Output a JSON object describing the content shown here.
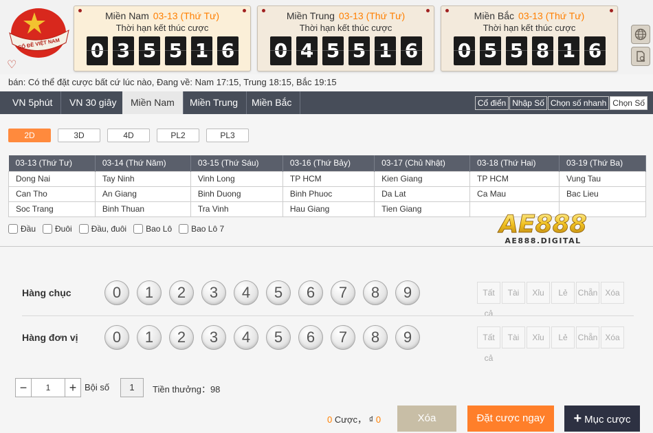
{
  "brand": {
    "logo_text": "SỐ ĐỀ VIỆT NAM",
    "colors": {
      "red": "#d8281d",
      "gold": "#f2c230",
      "orange": "#ff7f2a",
      "dark": "#474d59"
    }
  },
  "panels": [
    {
      "region": "Miền Nam",
      "date": "03-13 (Thứ Tư)",
      "subtitle": "Thời hạn kết thúc cược",
      "digits": [
        "0",
        "3",
        "5",
        "5",
        "1",
        "6"
      ]
    },
    {
      "region": "Miền Trung",
      "date": "03-13 (Thứ Tư)",
      "subtitle": "Thời hạn kết thúc cược",
      "digits": [
        "0",
        "4",
        "5",
        "5",
        "1",
        "6"
      ]
    },
    {
      "region": "Miền Bắc",
      "date": "03-13 (Thứ Tư)",
      "subtitle": "Thời hạn kết thúc cược",
      "digits": [
        "0",
        "5",
        "5",
        "8",
        "1",
        "6"
      ]
    }
  ],
  "side_icons": [
    "globe-icon",
    "document-icon"
  ],
  "ticker": "bán: Có thể đặt cược bất cứ lúc nào,   Đang về: Nam 17:15, Trung 18:15, Bắc 19:15",
  "tabs": [
    "VN 5phút",
    "VN 30 giây",
    "Miền Nam",
    "Miền Trung",
    "Miền Bắc"
  ],
  "active_tab": "Miền Nam",
  "modes": [
    "Cổ điển",
    "Nhập Số",
    "Chọn số nhanh",
    "Chọn Số"
  ],
  "active_mode": "Chọn Số",
  "bet_types": [
    "2D",
    "3D",
    "4D",
    "PL2",
    "PL3"
  ],
  "active_bet_type": "2D",
  "schedule": {
    "headers": [
      "03-13 (Thứ Tư)",
      "03-14 (Thứ Năm)",
      "03-15 (Thứ Sáu)",
      "03-16 (Thứ Bảy)",
      "03-17 (Chủ Nhật)",
      "03-18 (Thứ Hai)",
      "03-19 (Thứ Ba)"
    ],
    "rows": [
      [
        "Dong Nai",
        "Tay Ninh",
        "Vinh Long",
        "TP HCM",
        "Kien Giang",
        "TP HCM",
        "Vung Tau"
      ],
      [
        "Can Tho",
        "An Giang",
        "Binh Duong",
        "Binh Phuoc",
        "Da Lat",
        "Ca Mau",
        "Bac Lieu"
      ],
      [
        "Soc Trang",
        "Binh Thuan",
        "Tra Vinh",
        "Hau Giang",
        "Tien Giang",
        "",
        ""
      ]
    ]
  },
  "options": [
    "Đầu",
    "Đuôi",
    "Đầu, đuôi",
    "Bao Lô",
    "Bao Lô 7"
  ],
  "watermark": {
    "big": "AE888",
    "small": "AE888.DIGITAL"
  },
  "rows": [
    {
      "label": "Hàng chục",
      "numbers": [
        "0",
        "1",
        "2",
        "3",
        "4",
        "5",
        "6",
        "7",
        "8",
        "9"
      ]
    },
    {
      "label": "Hàng đơn vị",
      "numbers": [
        "0",
        "1",
        "2",
        "3",
        "4",
        "5",
        "6",
        "7",
        "8",
        "9"
      ]
    }
  ],
  "quick_picks": [
    "Tất cả",
    "Tài",
    "Xỉu",
    "Lẻ",
    "Chẵn",
    "Xóa"
  ],
  "stepper": {
    "minus": "−",
    "value": "1",
    "plus": "+"
  },
  "multiplier": {
    "label": "Bội số",
    "value": "1"
  },
  "prize": "Tiền thưởng：98",
  "summary": {
    "count": "0",
    "count_label": "Cược，",
    "currency": "₫",
    "amount": "0"
  },
  "buttons": {
    "clear": "Xóa",
    "bet": "Đặt cược ngay",
    "add": "Mục cược",
    "add_icon": "+"
  }
}
